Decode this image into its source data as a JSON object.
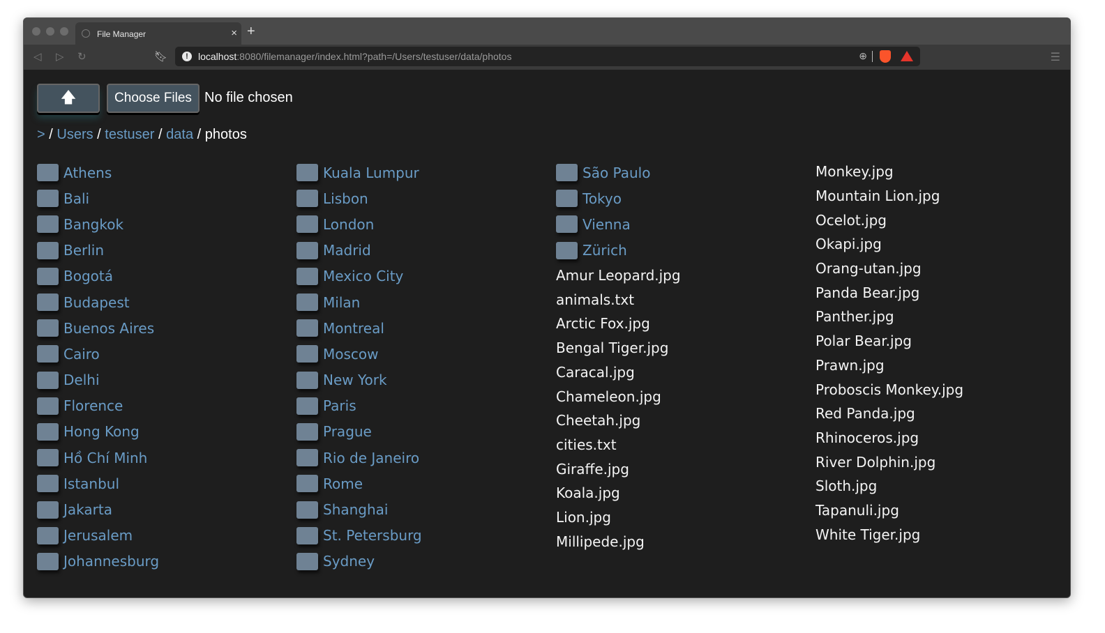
{
  "browser": {
    "tab_title": "File Manager",
    "url_host": "localhost",
    "url_rest": ":8080/filemanager/index.html?path=/Users/testuser/data/photos"
  },
  "toolbar": {
    "up_label": "🡅",
    "choose_files": "Choose Files",
    "no_file": "No file chosen"
  },
  "breadcrumb": {
    "root": ">",
    "sep": "/",
    "items": [
      "Users",
      "testuser",
      "data"
    ],
    "current": "photos"
  },
  "folders": [
    "Athens",
    "Bali",
    "Bangkok",
    "Berlin",
    "Bogotá",
    "Budapest",
    "Buenos Aires",
    "Cairo",
    "Delhi",
    "Florence",
    "Hong Kong",
    "Hồ Chí Minh",
    "Istanbul",
    "Jakarta",
    "Jerusalem",
    "Johannesburg",
    "Kuala Lumpur",
    "Lisbon",
    "London",
    "Madrid",
    "Mexico City",
    "Milan",
    "Montreal",
    "Moscow",
    "New York",
    "Paris",
    "Prague",
    "Rio de Janeiro",
    "Rome",
    "Shanghai",
    "St. Petersburg",
    "Sydney",
    "São Paulo",
    "Tokyo",
    "Vienna",
    "Zürich"
  ],
  "files": [
    "Amur Leopard.jpg",
    "animals.txt",
    "Arctic Fox.jpg",
    "Bengal Tiger.jpg",
    "Caracal.jpg",
    "Chameleon.jpg",
    "Cheetah.jpg",
    "cities.txt",
    "Giraffe.jpg",
    "Koala.jpg",
    "Lion.jpg",
    "Millipede.jpg",
    "Monkey.jpg",
    "Mountain Lion.jpg",
    "Ocelot.jpg",
    "Okapi.jpg",
    "Orang-utan.jpg",
    "Panda Bear.jpg",
    "Panther.jpg",
    "Polar Bear.jpg",
    "Prawn.jpg",
    "Proboscis Monkey.jpg",
    "Red Panda.jpg",
    "Rhinoceros.jpg",
    "River Dolphin.jpg",
    "Sloth.jpg",
    "Tapanuli.jpg",
    "White Tiger.jpg"
  ]
}
